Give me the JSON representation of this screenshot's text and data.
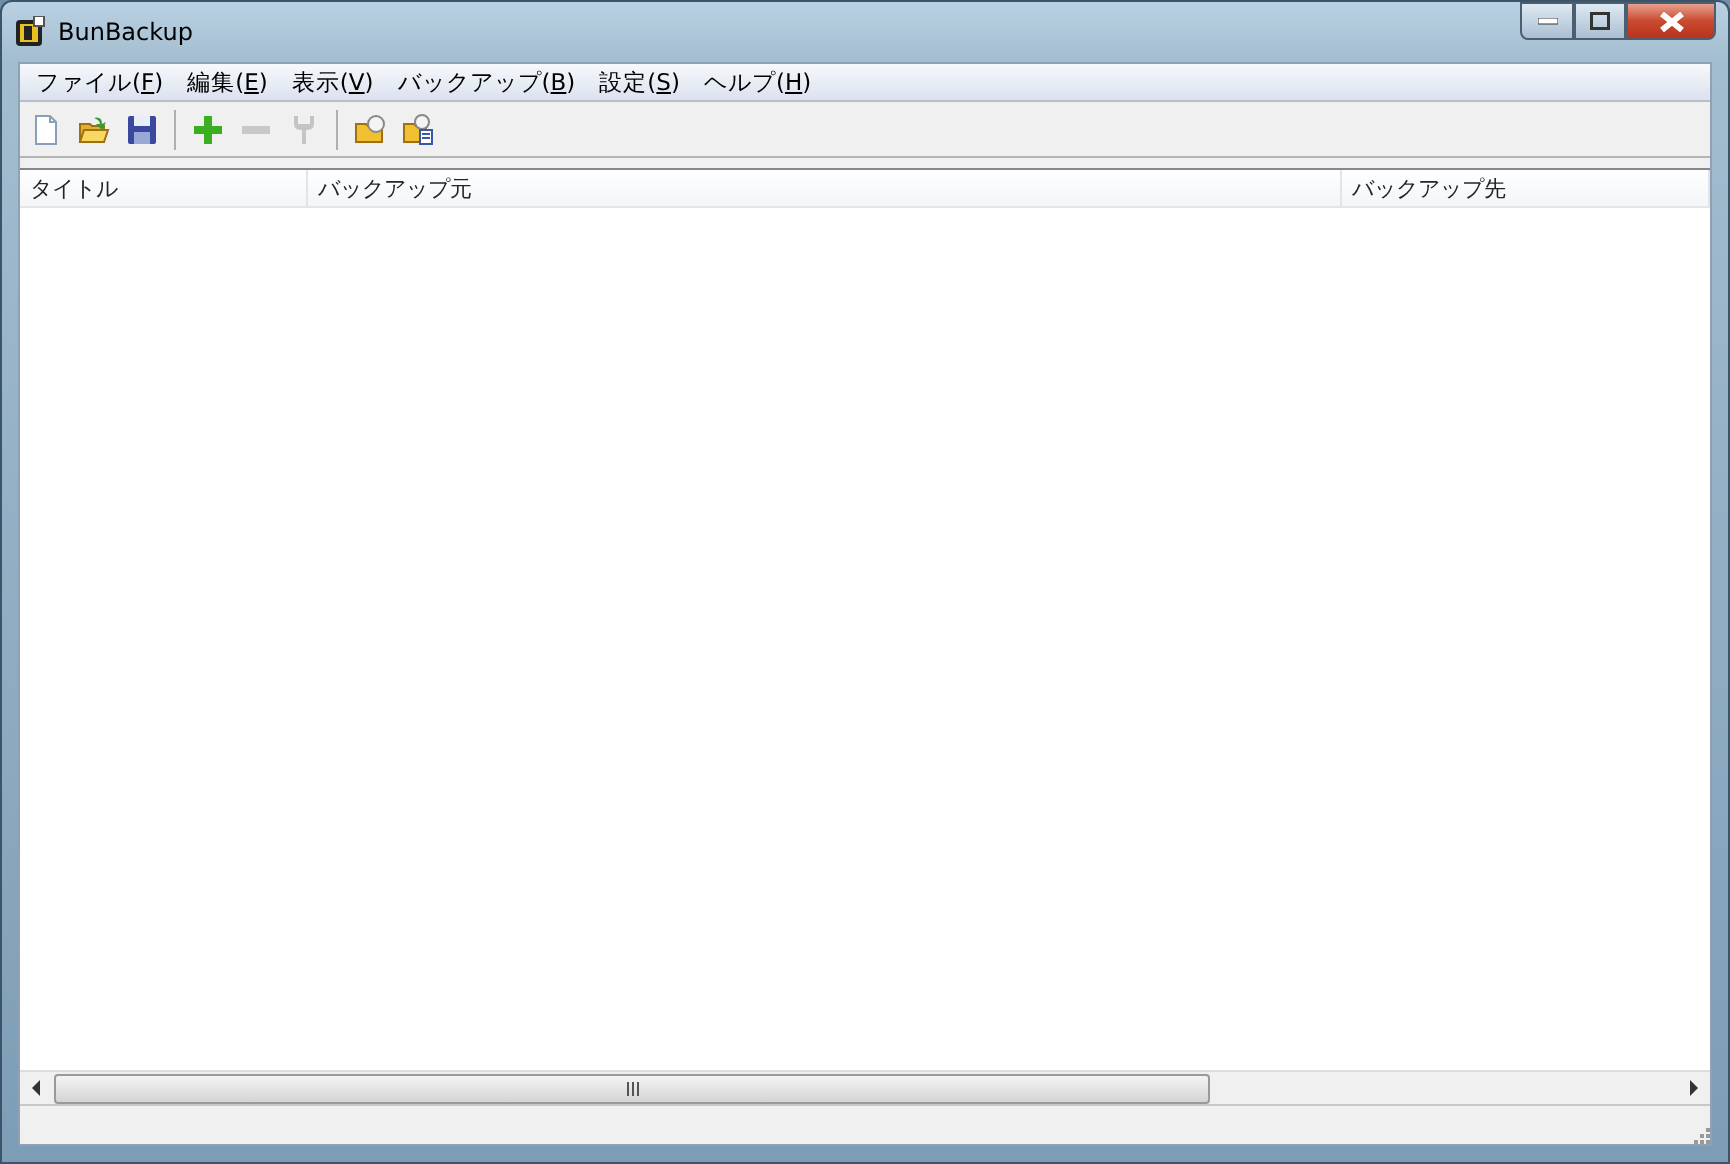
{
  "window": {
    "title": "BunBackup"
  },
  "menu": [
    {
      "before": "ファイル(",
      "accel": "F",
      "after": ")"
    },
    {
      "before": "編集(",
      "accel": "E",
      "after": ")"
    },
    {
      "before": "表示(",
      "accel": "V",
      "after": ")"
    },
    {
      "before": "バックアップ(",
      "accel": "B",
      "after": ")"
    },
    {
      "before": "設定(",
      "accel": "S",
      "after": ")"
    },
    {
      "before": "ヘルプ(",
      "accel": "H",
      "after": ")"
    }
  ],
  "toolbar": [
    {
      "kind": "new",
      "disabled": false
    },
    {
      "kind": "open",
      "disabled": false
    },
    {
      "kind": "save",
      "disabled": false
    },
    {
      "kind": "separator"
    },
    {
      "kind": "add",
      "disabled": false
    },
    {
      "kind": "remove",
      "disabled": true
    },
    {
      "kind": "settings",
      "disabled": true
    },
    {
      "kind": "separator"
    },
    {
      "kind": "folder",
      "disabled": false
    },
    {
      "kind": "folder-file",
      "disabled": false
    }
  ],
  "table": {
    "columns": [
      "タイトル",
      "バックアップ元",
      "バックアップ先"
    ]
  }
}
